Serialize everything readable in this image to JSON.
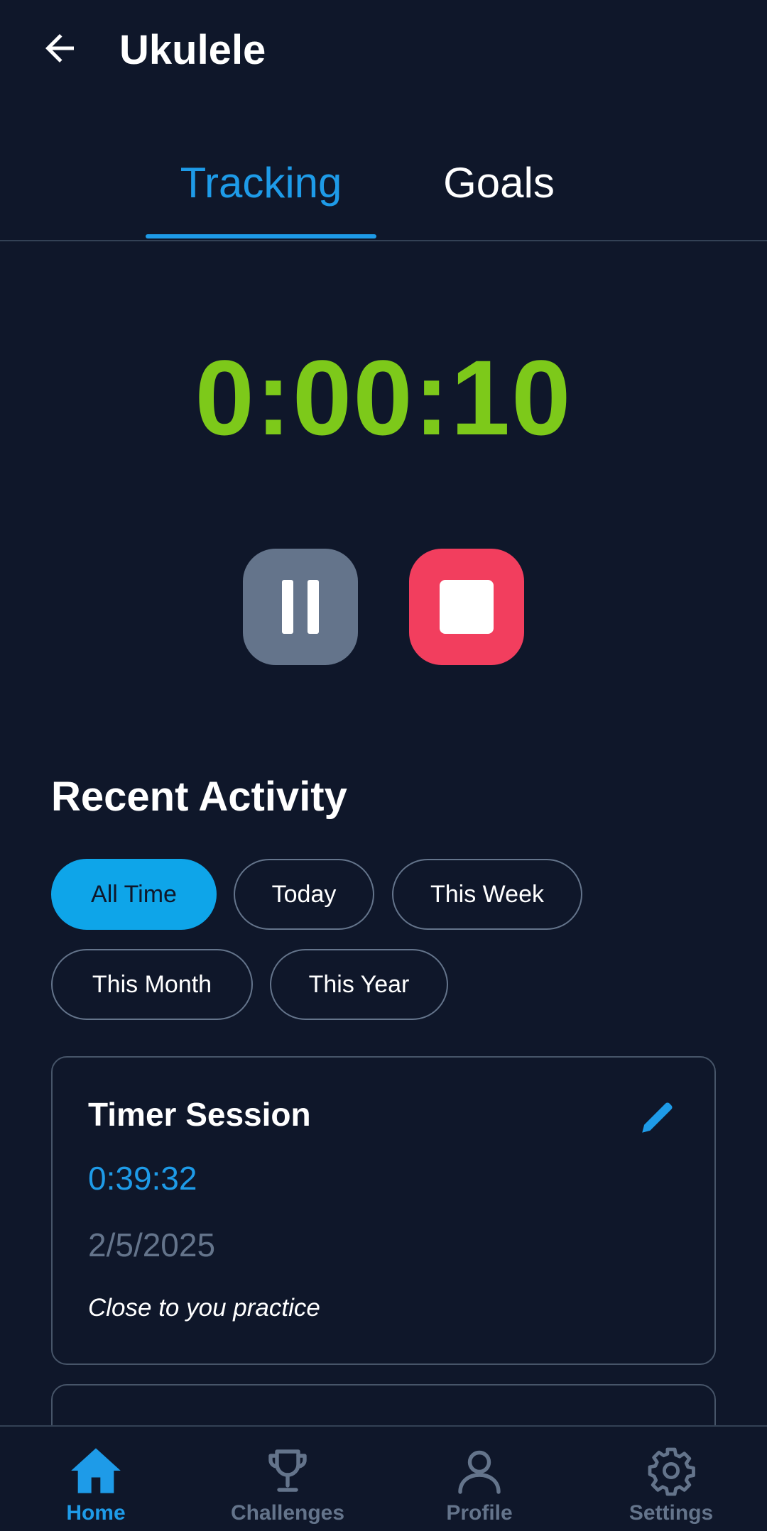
{
  "header": {
    "title": "Ukulele",
    "back_icon": "arrow-left-icon"
  },
  "tabs": [
    {
      "label": "Tracking",
      "active": true
    },
    {
      "label": "Goals",
      "active": false
    }
  ],
  "timer": {
    "display": "0:00:10",
    "color": "#7dc91a"
  },
  "controls": {
    "pause": {
      "icon": "pause-icon",
      "color": "#64748b"
    },
    "stop": {
      "icon": "stop-icon",
      "color": "#f23e5e"
    }
  },
  "recent_activity": {
    "title": "Recent Activity",
    "filters": [
      {
        "label": "All Time",
        "active": true
      },
      {
        "label": "Today",
        "active": false
      },
      {
        "label": "This Week",
        "active": false
      },
      {
        "label": "This Month",
        "active": false
      },
      {
        "label": "This Year",
        "active": false
      }
    ],
    "sessions": [
      {
        "title": "Timer Session",
        "duration": "0:39:32",
        "date": "2/5/2025",
        "note": "Close to you practice"
      }
    ]
  },
  "bottom_nav": [
    {
      "label": "Home",
      "icon": "home-icon",
      "active": true
    },
    {
      "label": "Challenges",
      "icon": "trophy-icon",
      "active": false
    },
    {
      "label": "Profile",
      "icon": "person-icon",
      "active": false
    },
    {
      "label": "Settings",
      "icon": "gear-icon",
      "active": false
    }
  ],
  "colors": {
    "accent": "#1e9be8",
    "background": "#0f172a",
    "muted": "#64748b"
  }
}
